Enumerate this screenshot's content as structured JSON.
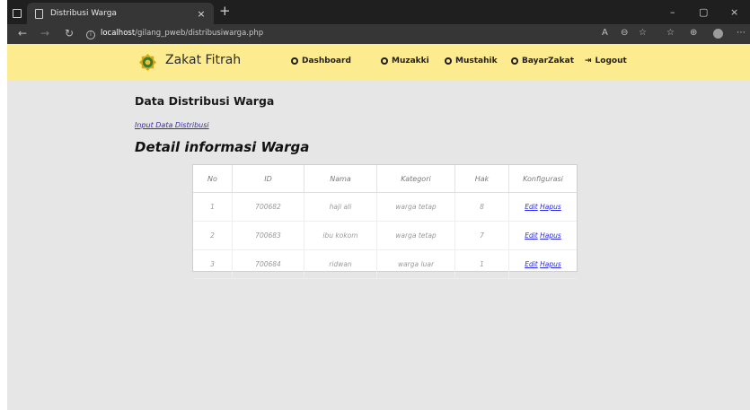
{
  "browser": {
    "tab_title": "Distribusi Warga",
    "tab_close": "×",
    "new_tab": "+",
    "url_host": "localhost",
    "url_path": "/gilang_pweb/distribusiwarga.php",
    "win_minimize": "–",
    "win_restore": "▢",
    "win_close": "×"
  },
  "navbar": {
    "brand": "Zakat Fitrah",
    "menu": {
      "dashboard": "Dashboard",
      "muzakki": "Muzakki",
      "mustahik": "Mustahik",
      "bayarzakat": "BayarZakat",
      "logout": "Logout"
    }
  },
  "main": {
    "page_title": "Data Distribusi Warga",
    "input_link": "Input Data Distribusi",
    "section_title": "Detail informasi Warga",
    "table": {
      "headers": [
        "No",
        "ID",
        "Nama",
        "Kategori",
        "Hak",
        "Konfigurasi"
      ],
      "rows": [
        {
          "no": "1",
          "id": "700682",
          "nama": "haji ali",
          "kategori": "warga tetap",
          "hak": "8",
          "edit": "Edit",
          "hapus": "Hapus"
        },
        {
          "no": "2",
          "id": "700683",
          "nama": "ibu kokom",
          "kategori": "warga tetap",
          "hak": "7",
          "edit": "Edit",
          "hapus": "Hapus"
        },
        {
          "no": "3",
          "id": "700684",
          "nama": "ridwan",
          "kategori": "warga luar",
          "hak": "1",
          "edit": "Edit",
          "hapus": "Hapus"
        }
      ]
    }
  }
}
